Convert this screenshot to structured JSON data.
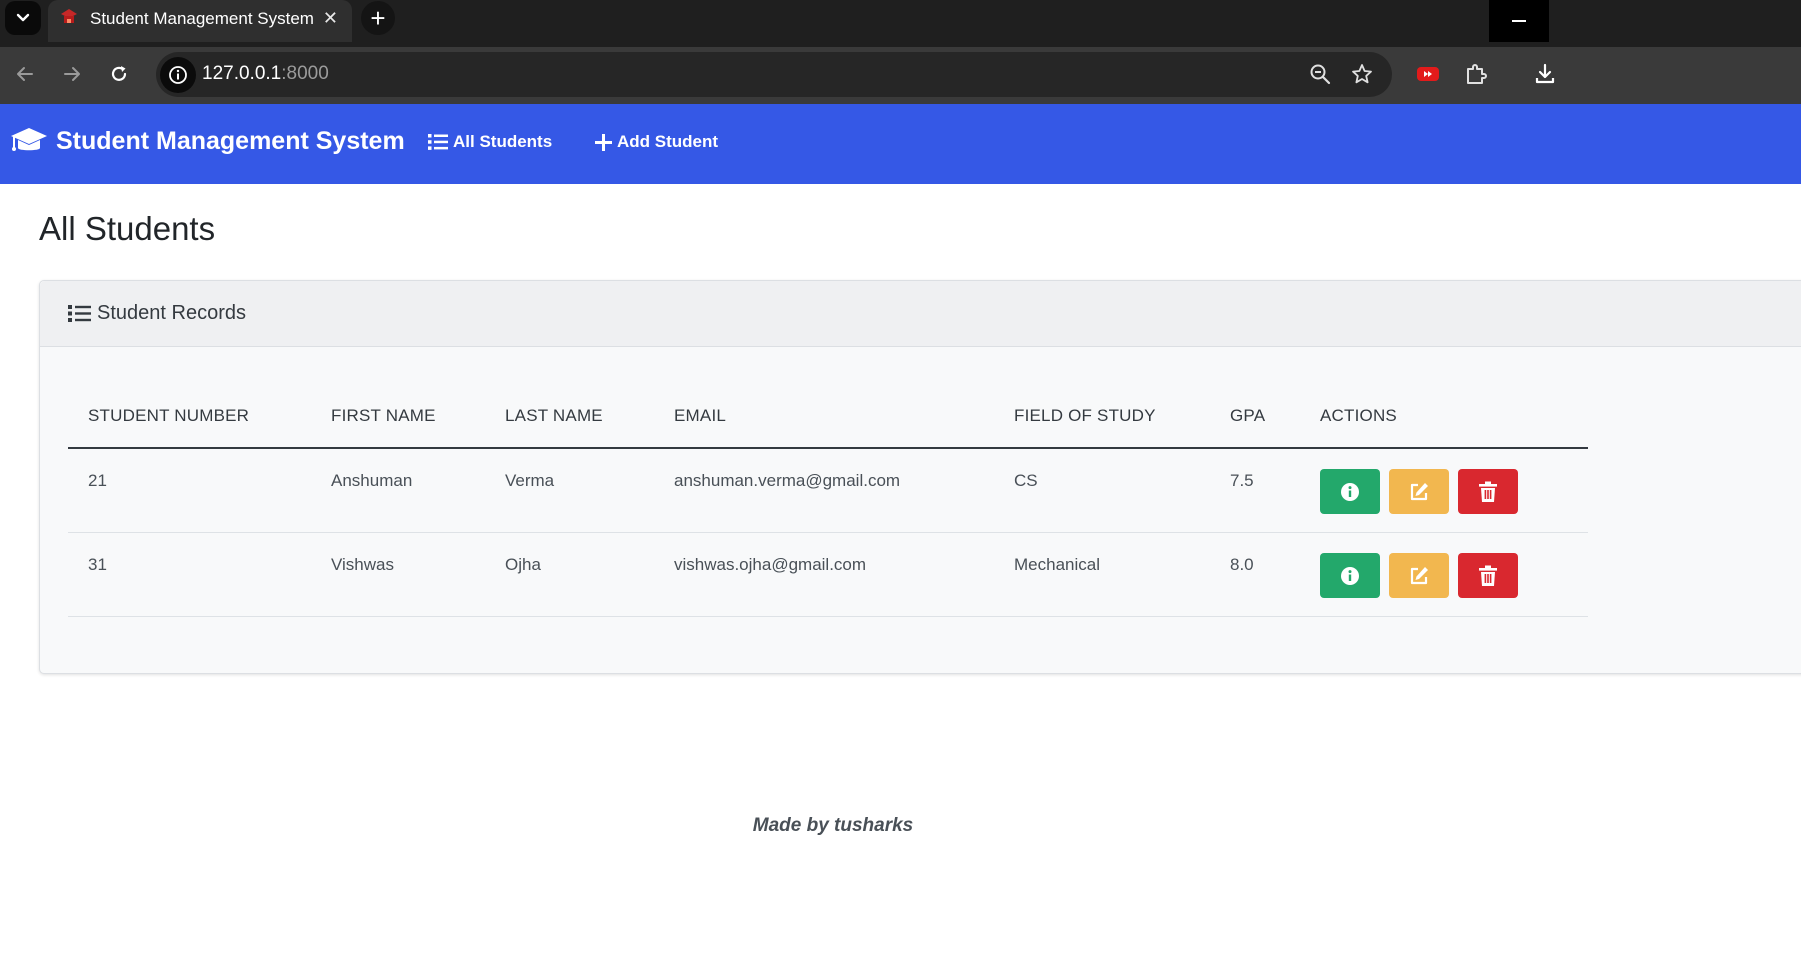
{
  "browser": {
    "tab_title": "Student Management System",
    "tab_close": "✕",
    "new_tab": "+",
    "url_host": "127.0.0.1",
    "url_port": ":8000"
  },
  "navbar": {
    "brand": "Student Management System",
    "links": [
      {
        "label": "All Students",
        "icon": "list-icon"
      },
      {
        "label": "Add Student",
        "icon": "plus-icon"
      }
    ]
  },
  "page": {
    "title": "All Students",
    "card_title": "Student Records"
  },
  "table": {
    "headers": [
      "STUDENT NUMBER",
      "FIRST NAME",
      "LAST NAME",
      "EMAIL",
      "FIELD OF STUDY",
      "GPA",
      "ACTIONS"
    ],
    "rows": [
      {
        "student_number": "21",
        "first_name": "Anshuman",
        "last_name": "Verma",
        "email": "anshuman.verma@gmail.com",
        "field": "CS",
        "gpa": "7.5"
      },
      {
        "student_number": "31",
        "first_name": "Vishwas",
        "last_name": "Ojha",
        "email": "vishwas.ojha@gmail.com",
        "field": "Mechanical",
        "gpa": "8.0"
      }
    ],
    "actions": [
      "info",
      "edit",
      "delete"
    ]
  },
  "footer": {
    "text": "Made by tusharks"
  },
  "colors": {
    "navbar": "#3558e6",
    "info": "#23a86b",
    "edit": "#f2b74f",
    "delete": "#d9282f"
  }
}
